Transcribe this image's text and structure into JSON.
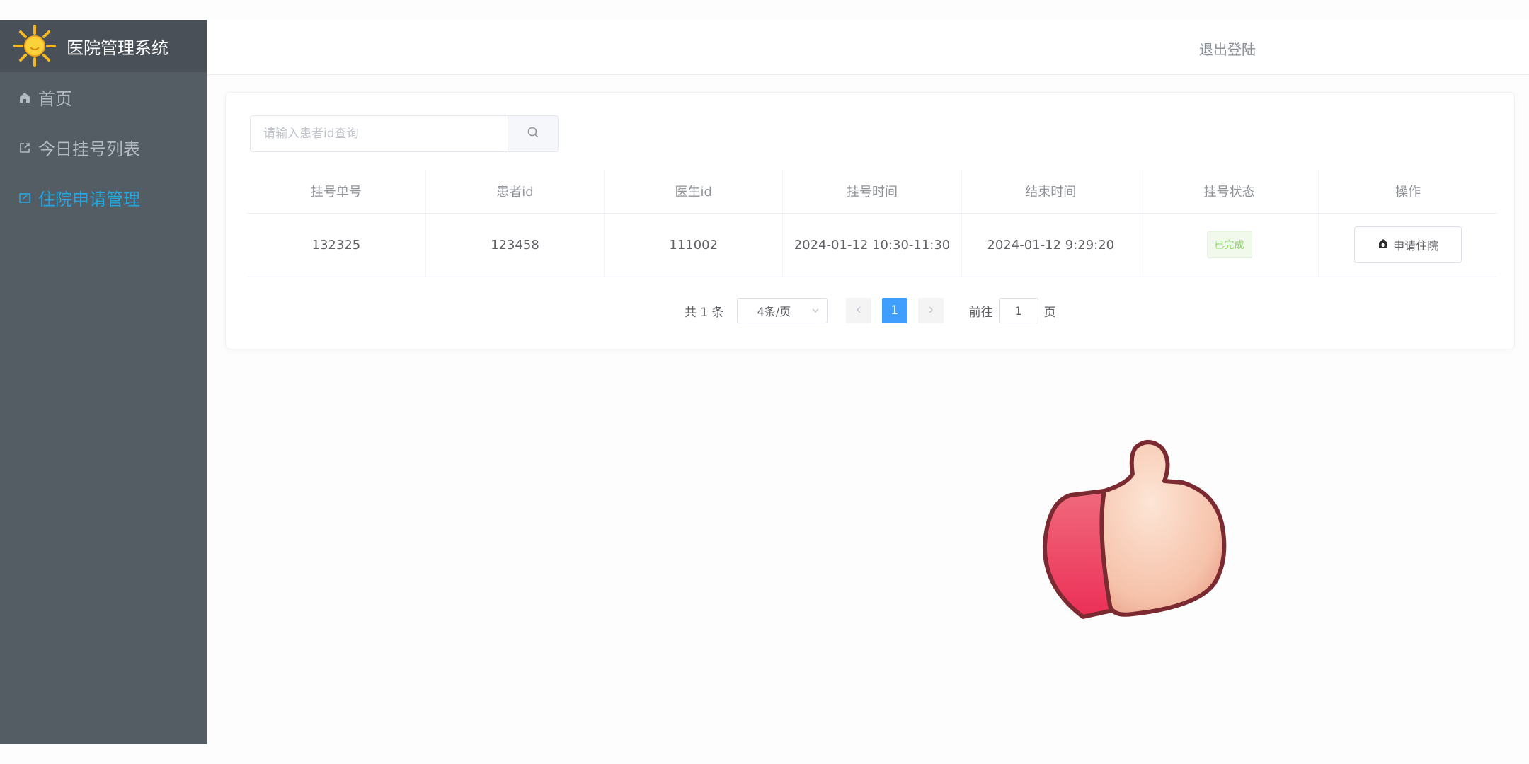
{
  "brand": {
    "title": "医院管理系统"
  },
  "sidebar": {
    "items": [
      {
        "label": "首页",
        "icon": "home-icon",
        "active": false
      },
      {
        "label": "今日挂号列表",
        "icon": "external-link-icon",
        "active": false
      },
      {
        "label": "住院申请管理",
        "icon": "edit-icon",
        "active": true
      }
    ]
  },
  "header": {
    "logout": "退出登陆"
  },
  "search": {
    "placeholder": "请输入患者id查询",
    "icon": "search-icon"
  },
  "table": {
    "columns": [
      "挂号单号",
      "患者id",
      "医生id",
      "挂号时间",
      "结束时间",
      "挂号状态",
      "操作"
    ],
    "rows": [
      {
        "reg_no": "132325",
        "patient_id": "123458",
        "doctor_id": "111002",
        "reg_time": "2024-01-12 10:30-11:30",
        "end_time": "2024-01-12 9:29:20",
        "status": "已完成",
        "action": "申请住院"
      }
    ]
  },
  "pagination": {
    "total": "共 1 条",
    "page_size": "4条/页",
    "current_page": "1",
    "goto_label": "前往",
    "goto_value": "1",
    "page_suffix": "页"
  },
  "colors": {
    "sidebar_bg": "#545c64",
    "accent": "#22a7e0",
    "primary": "#409eff",
    "status_green": "#8fd36b"
  }
}
